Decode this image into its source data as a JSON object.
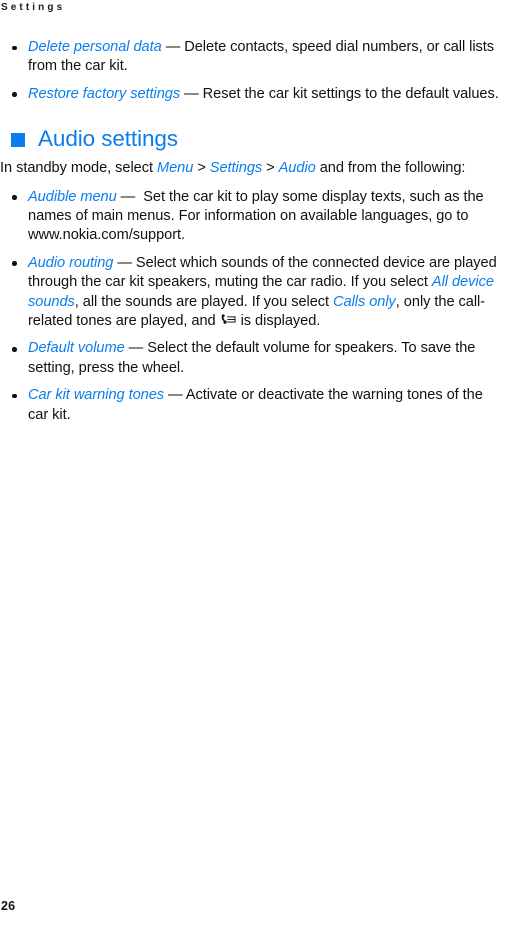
{
  "running_head": "Settings",
  "accent_color": "#0A7DEE",
  "text_color": "#111111",
  "top_list": [
    {
      "term": "Delete personal data",
      "dash": " — ",
      "description": "Delete contacts, speed dial numbers, or call lists from the car kit."
    },
    {
      "term": "Restore factory settings",
      "dash": " — ",
      "description": "Reset the car kit settings to the default values."
    }
  ],
  "section": {
    "bullet_icon": "blue-square-bullet",
    "heading": "Audio settings",
    "intro": {
      "lead": "In standby mode, select ",
      "path": [
        {
          "label": "Menu",
          "separator": " > "
        },
        {
          "label": "Settings",
          "separator": " > "
        },
        {
          "label": "Audio",
          "separator": ""
        }
      ],
      "tail": " and from the following:"
    },
    "items": [
      {
        "term": "Audible menu",
        "dash": " —  ",
        "description": "Set the car kit to play some display texts, such as the names of main menus. For information on available languages, go to www.nokia.com/support."
      },
      {
        "term": "Audio routing",
        "dash": " — ",
        "desc_part1": "Select which sounds of the connected device are played through the car kit speakers, muting the car radio. If you select ",
        "inline_term1": "All device sounds",
        "desc_part2": ", all the sounds are played. If you select ",
        "inline_term2": "Calls only",
        "desc_part3": ", only the call-related tones are played, and ",
        "inline_icon": "calls-only-icon",
        "desc_part4": " is displayed."
      },
      {
        "term": "Default volume",
        "dash": " — ",
        "description": "Select the default volume for speakers. To save the setting, press the wheel."
      },
      {
        "term": "Car kit warning tones",
        "dash": " — ",
        "description": "Activate or deactivate the warning tones of the car kit."
      }
    ]
  },
  "folio": "26"
}
